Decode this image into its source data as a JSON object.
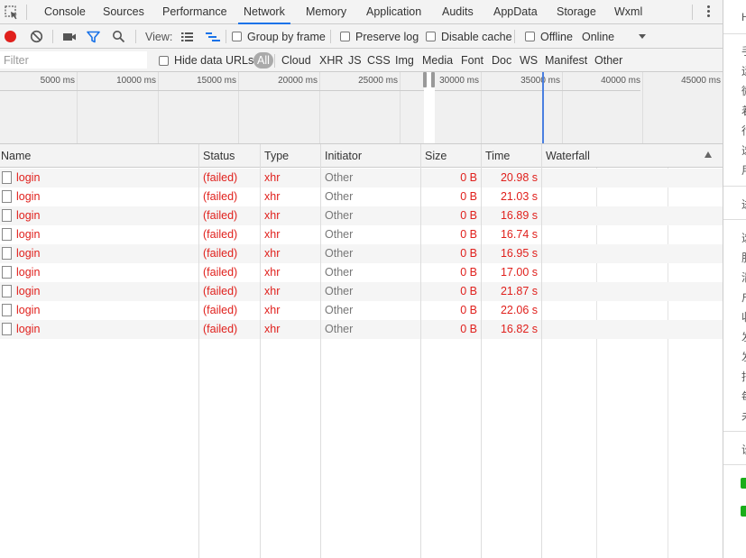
{
  "tabs": [
    "Console",
    "Sources",
    "Performance",
    "Network",
    "Memory",
    "Application",
    "Audits",
    "AppData",
    "Storage",
    "Wxml"
  ],
  "active_tab": "Network",
  "toolbar": {
    "view_label": "View:",
    "group_by_frame": "Group by frame",
    "preserve_log": "Preserve log",
    "disable_cache": "Disable cache",
    "offline": "Offline",
    "throttle": "Online"
  },
  "filter": {
    "placeholder": "Filter",
    "hide_data_urls": "Hide data URLs",
    "types": [
      "All",
      "Cloud",
      "XHR",
      "JS",
      "CSS",
      "Img",
      "Media",
      "Font",
      "Doc",
      "WS",
      "Manifest",
      "Other"
    ],
    "active_type": "All"
  },
  "overview": {
    "ticks": [
      "5000 ms",
      "10000 ms",
      "15000 ms",
      "20000 ms",
      "25000 ms",
      "30000 ms",
      "35000 ms",
      "40000 ms",
      "45000 ms"
    ]
  },
  "table": {
    "columns": [
      "Name",
      "Status",
      "Type",
      "Initiator",
      "Size",
      "Time",
      "Waterfall"
    ],
    "rows": [
      {
        "name": "login",
        "status": "(failed)",
        "type": "xhr",
        "initiator": "Other",
        "size": "0 B",
        "time": "20.98 s"
      },
      {
        "name": "login",
        "status": "(failed)",
        "type": "xhr",
        "initiator": "Other",
        "size": "0 B",
        "time": "21.03 s"
      },
      {
        "name": "login",
        "status": "(failed)",
        "type": "xhr",
        "initiator": "Other",
        "size": "0 B",
        "time": "16.89 s"
      },
      {
        "name": "login",
        "status": "(failed)",
        "type": "xhr",
        "initiator": "Other",
        "size": "0 B",
        "time": "16.74 s"
      },
      {
        "name": "login",
        "status": "(failed)",
        "type": "xhr",
        "initiator": "Other",
        "size": "0 B",
        "time": "16.95 s"
      },
      {
        "name": "login",
        "status": "(failed)",
        "type": "xhr",
        "initiator": "Other",
        "size": "0 B",
        "time": "17.00 s"
      },
      {
        "name": "login",
        "status": "(failed)",
        "type": "xhr",
        "initiator": "Other",
        "size": "0 B",
        "time": "21.87 s"
      },
      {
        "name": "login",
        "status": "(failed)",
        "type": "xhr",
        "initiator": "Other",
        "size": "0 B",
        "time": "22.06 s"
      },
      {
        "name": "login",
        "status": "(failed)",
        "type": "xhr",
        "initiator": "Other",
        "size": "0 B",
        "time": "16.82 s"
      }
    ]
  },
  "side_panel": {
    "glyphs": [
      "H",
      "手",
      "运",
      "微",
      "着",
      "行",
      "选",
      "用",
      "进",
      "选",
      "服",
      "清",
      "户",
      "收",
      "发",
      "发",
      "指",
      "每",
      "未",
      "设"
    ]
  },
  "colors": {
    "failed_text": "#e0201c",
    "record": "#e0201c",
    "active_tab_underline": "#1a73e8",
    "timeline_marker": "#4a7fe0",
    "side_check": "#1aad19"
  },
  "icons": [
    "inspect-icon",
    "record-icon",
    "clear-icon",
    "camera-icon",
    "filter-icon",
    "search-icon",
    "list-view-icon",
    "waterfall-view-icon",
    "kebab-menu-icon",
    "dropdown-arrow-icon",
    "document-icon",
    "sort-asc-icon",
    "checkbox-checked-icon"
  ]
}
